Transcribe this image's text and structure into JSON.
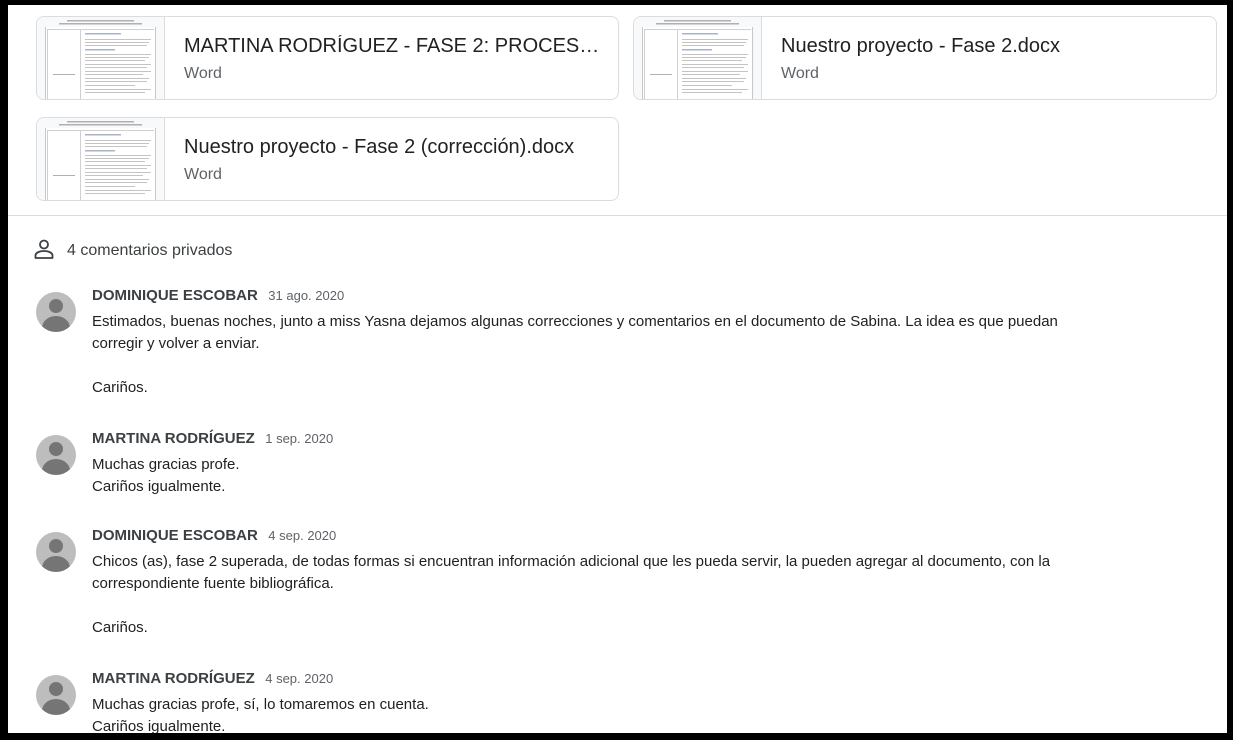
{
  "attachments": [
    {
      "title": "MARTINA RODRÍGUEZ - FASE 2: PROCESO ...",
      "type": "Word"
    },
    {
      "title": "Nuestro proyecto - Fase 2.docx",
      "type": "Word"
    },
    {
      "title": "Nuestro proyecto - Fase 2 (corrección).docx",
      "type": "Word"
    }
  ],
  "comments_header": {
    "icon": "person-icon",
    "label": "4 comentarios privados"
  },
  "comments": [
    {
      "author": "DOMINIQUE ESCOBAR",
      "date": "31 ago. 2020",
      "line1": "Estimados, buenas noches, junto a miss Yasna dejamos algunas correcciones y comentarios en el documento de Sabina. La idea es que puedan",
      "line2": "corregir y volver a enviar.",
      "line3": "Cariños."
    },
    {
      "author": "MARTINA RODRÍGUEZ",
      "date": "1 sep. 2020",
      "line1": "Muchas gracias profe.",
      "line2": "Cariños igualmente."
    },
    {
      "author": "DOMINIQUE ESCOBAR",
      "date": "4 sep. 2020",
      "line1": "Chicos (as), fase 2 superada, de todas formas si encuentran información adicional que les pueda servir, la pueden agregar al documento, con la",
      "line2": "correspondiente fuente bibliográfica.",
      "line3": "Cariños."
    },
    {
      "author": "MARTINA RODRÍGUEZ",
      "date": "4 sep. 2020",
      "line1": "Muchas gracias profe, sí, lo tomaremos en cuenta.",
      "line2": "Cariños igualmente."
    }
  ],
  "colors": {
    "border": "#dadce0",
    "avatar_bg": "#bdbdbd",
    "avatar_fg": "#757575",
    "text": "#202124",
    "muted": "#5f6368"
  }
}
